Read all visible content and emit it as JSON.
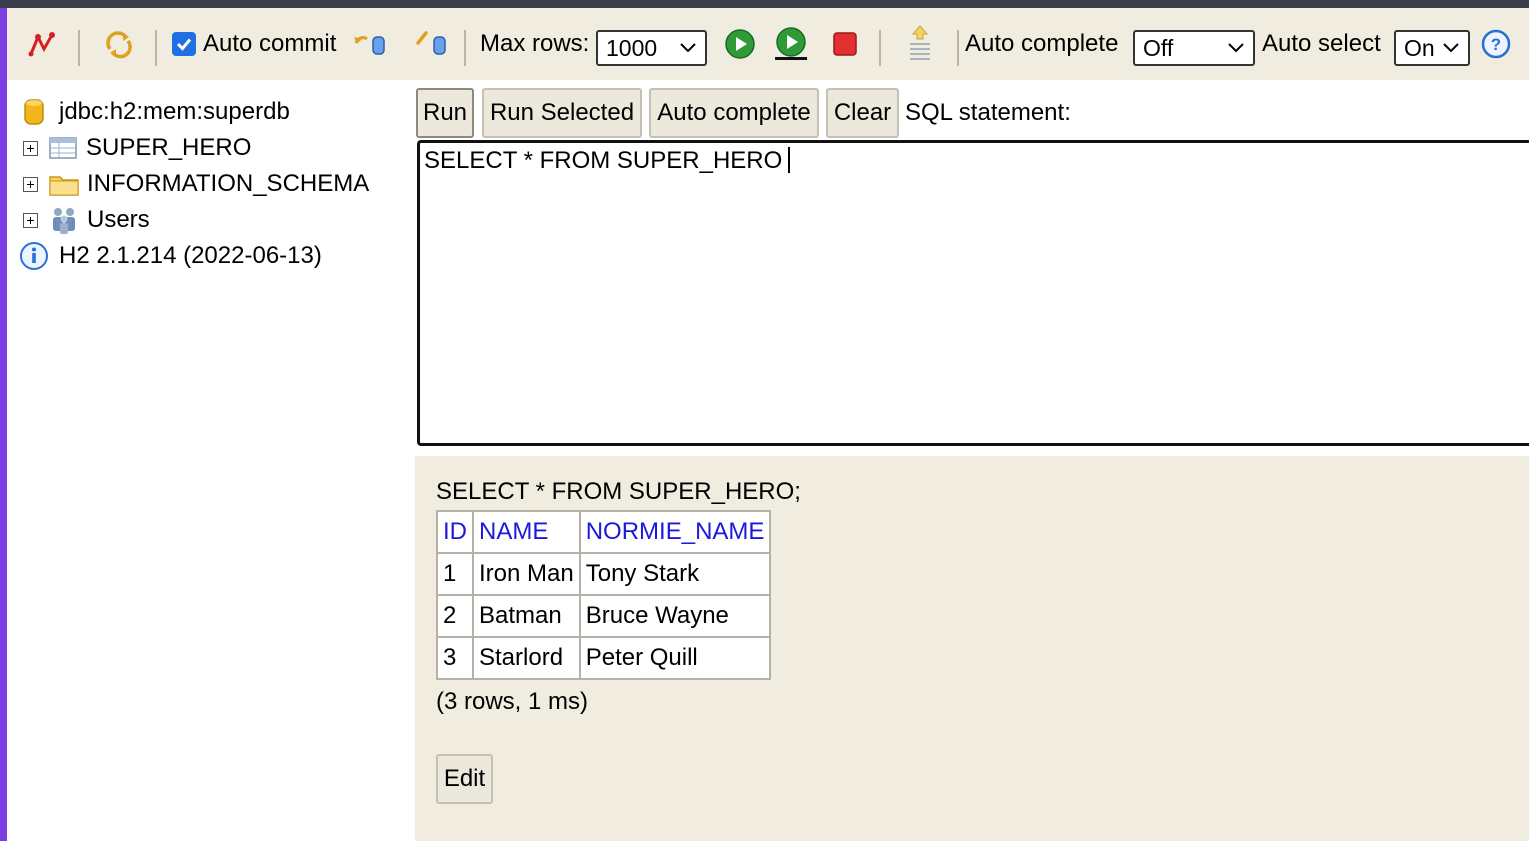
{
  "toolbar": {
    "disconnect_icon": "disconnect-icon",
    "refresh_icon": "refresh-icon",
    "auto_commit_label": "Auto commit",
    "auto_commit_checked": true,
    "rollback_icon": "rollback-icon",
    "commit_icon": "commit-icon",
    "max_rows_label": "Max rows:",
    "max_rows_value": "1000",
    "run_icon": "run-icon",
    "run_selected_icon": "run-selected-icon",
    "stop_icon": "stop-icon",
    "history_icon": "history-icon",
    "auto_complete_label": "Auto complete",
    "auto_complete_value": "Off",
    "auto_select_label": "Auto select",
    "auto_select_value": "On",
    "help_icon": "help-icon"
  },
  "tree": {
    "connection": "jdbc:h2:mem:superdb",
    "items": [
      {
        "label": "SUPER_HERO",
        "icon": "table-icon"
      },
      {
        "label": "INFORMATION_SCHEMA",
        "icon": "folder-icon"
      },
      {
        "label": "Users",
        "icon": "users-icon"
      }
    ],
    "version": "H2 2.1.214 (2022-06-13)"
  },
  "editor": {
    "buttons": {
      "run": "Run",
      "run_selected": "Run Selected",
      "auto_complete": "Auto complete",
      "clear": "Clear"
    },
    "sql_label": "SQL statement:",
    "sql_text": "SELECT * FROM SUPER_HERO"
  },
  "results": {
    "query": "SELECT * FROM SUPER_HERO;",
    "columns": [
      "ID",
      "NAME",
      "NORMIE_NAME"
    ],
    "rows": [
      [
        "1",
        "Iron Man",
        "Tony Stark"
      ],
      [
        "2",
        "Batman",
        "Bruce Wayne"
      ],
      [
        "3",
        "Starlord",
        "Peter Quill"
      ]
    ],
    "summary": "(3 rows, 1 ms)",
    "edit_label": "Edit"
  }
}
